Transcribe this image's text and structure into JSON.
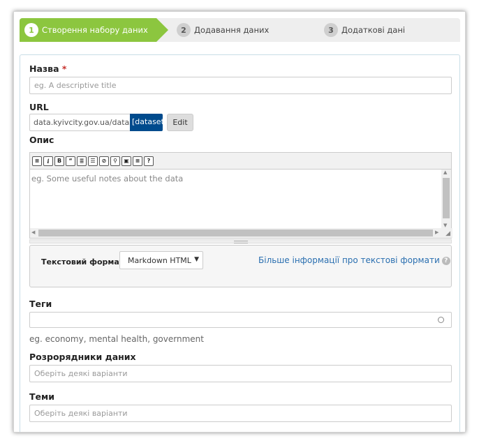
{
  "stages": [
    {
      "number": "1",
      "label": "Створення набору даних"
    },
    {
      "number": "2",
      "label": "Додавання даних"
    },
    {
      "number": "3",
      "label": "Додаткові дані"
    }
  ],
  "form": {
    "title": {
      "label": "Назва",
      "required_mark": "*",
      "placeholder": "eg. A descriptive title"
    },
    "url": {
      "label": "URL",
      "prefix": "data.kyivcity.gov.ua/dataset/",
      "slug": "[dataset]",
      "edit_label": "Edit"
    },
    "description": {
      "label": "Опис",
      "placeholder": "eg. Some useful notes about the data",
      "toolbar_icons": [
        "paragraph-icon",
        "italic-icon",
        "bold-icon",
        "quote-icon",
        "ordered-list-icon",
        "unordered-list-icon",
        "link-icon",
        "unlink-icon",
        "image-icon",
        "code-icon",
        "help-icon"
      ],
      "toolbar_glyphs": [
        "≡",
        "i",
        "B",
        "“",
        "≣",
        "☰",
        "⊘",
        "⚲",
        "▣",
        "≡",
        "?"
      ]
    },
    "text_format": {
      "label": "Текстовий формат",
      "selected": "Markdown HTML",
      "more_info_link": "Більше інформації про текстові формати",
      "help_glyph": "?"
    },
    "tags": {
      "label": "Теги",
      "help": "eg. economy, mental health, government"
    },
    "publishers": {
      "label": "Розрорядники даних",
      "placeholder": "Оберіть деякі варіанти"
    },
    "topics": {
      "label": "Теми",
      "placeholder": "Оберіть деякі варіанти"
    }
  },
  "colors": {
    "accent": "#8cc63f",
    "link": "#2a6fb0",
    "slug_bg": "#004b8d",
    "required": "#c6302b"
  }
}
